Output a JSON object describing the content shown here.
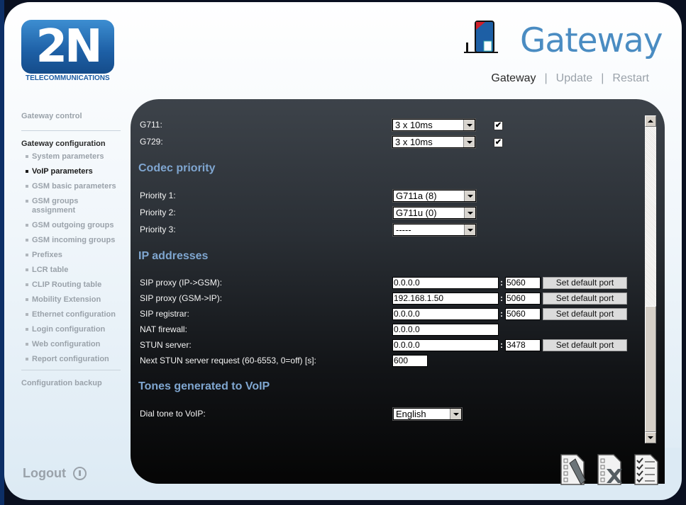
{
  "brand": {
    "logo_text": "2N",
    "logo_subtitle": "TELECOMMUNICATIONS"
  },
  "header": {
    "title": "Gateway",
    "nav": [
      {
        "label": "Gateway",
        "active": true
      },
      {
        "label": "Update",
        "active": false
      },
      {
        "label": "Restart",
        "active": false
      }
    ],
    "separator": "|"
  },
  "sidebar": {
    "gateway_control": "Gateway control",
    "gateway_configuration": "Gateway configuration",
    "items": [
      {
        "label": "System parameters"
      },
      {
        "label": "VoIP parameters",
        "active": true
      },
      {
        "label": "GSM basic parameters"
      },
      {
        "label": "GSM groups assignment"
      },
      {
        "label": "GSM outgoing groups"
      },
      {
        "label": "GSM incoming groups"
      },
      {
        "label": "Prefixes"
      },
      {
        "label": "LCR table"
      },
      {
        "label": "CLIP Routing table"
      },
      {
        "label": "Mobility Extension"
      },
      {
        "label": "Ethernet configuration"
      },
      {
        "label": "Login configuration"
      },
      {
        "label": "Web configuration"
      },
      {
        "label": "Report configuration"
      }
    ],
    "configuration_backup": "Configuration backup",
    "logout": "Logout"
  },
  "form": {
    "codecs": [
      {
        "label": "G711:",
        "value": "3 x 10ms",
        "enabled": true
      },
      {
        "label": "G729:",
        "value": "3 x 10ms",
        "enabled": true
      }
    ],
    "codec_priority": {
      "title": "Codec priority",
      "items": [
        {
          "label": "Priority 1:",
          "value": "G711a (8)"
        },
        {
          "label": "Priority 2:",
          "value": "G711u (0)"
        },
        {
          "label": "Priority 3:",
          "value": "-----"
        }
      ]
    },
    "ip_addresses": {
      "title": "IP addresses",
      "sip_proxy_ip_gsm": {
        "label": "SIP proxy (IP->GSM):",
        "address": "0.0.0.0",
        "port": "5060"
      },
      "sip_proxy_gsm_ip": {
        "label": "SIP proxy (GSM->IP):",
        "address": "192.168.1.50",
        "port": "5060"
      },
      "sip_registrar": {
        "label": "SIP registrar:",
        "address": "0.0.0.0",
        "port": "5060"
      },
      "nat_firewall": {
        "label": "NAT firewall:",
        "address": "0.0.0.0"
      },
      "stun_server": {
        "label": "STUN server:",
        "address": "0.0.0.0",
        "port": "3478"
      },
      "next_stun": {
        "label": "Next STUN server request (60-6553, 0=off) [s]:",
        "value": "600"
      },
      "set_default_port_label": "Set default port",
      "colon": ":"
    },
    "tones": {
      "title": "Tones generated to VoIP",
      "dial_tone": {
        "label": "Dial tone to VoIP:",
        "value": "English"
      }
    }
  },
  "colors": {
    "accent": "#4a8cc2",
    "section_title": "#7fa6d0",
    "panel_dark": "#2a2f35"
  }
}
